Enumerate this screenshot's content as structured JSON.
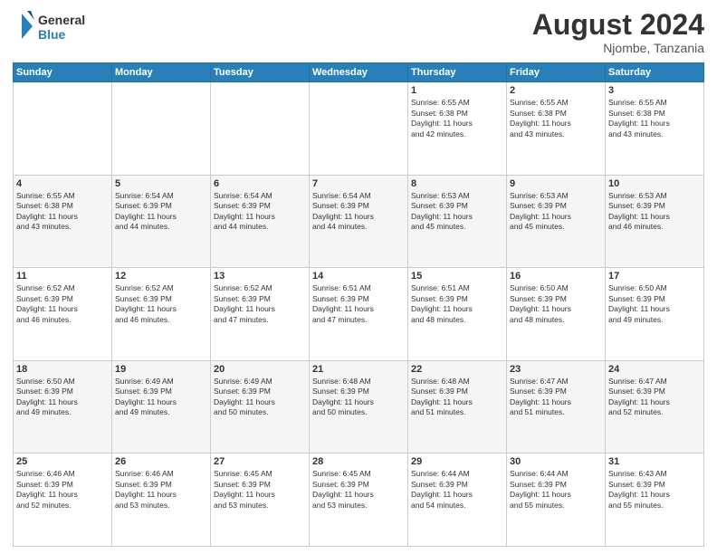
{
  "header": {
    "logo_text_general": "General",
    "logo_text_blue": "Blue",
    "month_year": "August 2024",
    "location": "Njombe, Tanzania"
  },
  "weekdays": [
    "Sunday",
    "Monday",
    "Tuesday",
    "Wednesday",
    "Thursday",
    "Friday",
    "Saturday"
  ],
  "weeks": [
    [
      {
        "day": "",
        "info": ""
      },
      {
        "day": "",
        "info": ""
      },
      {
        "day": "",
        "info": ""
      },
      {
        "day": "",
        "info": ""
      },
      {
        "day": "1",
        "info": "Sunrise: 6:55 AM\nSunset: 6:38 PM\nDaylight: 11 hours\nand 42 minutes."
      },
      {
        "day": "2",
        "info": "Sunrise: 6:55 AM\nSunset: 6:38 PM\nDaylight: 11 hours\nand 43 minutes."
      },
      {
        "day": "3",
        "info": "Sunrise: 6:55 AM\nSunset: 6:38 PM\nDaylight: 11 hours\nand 43 minutes."
      }
    ],
    [
      {
        "day": "4",
        "info": "Sunrise: 6:55 AM\nSunset: 6:38 PM\nDaylight: 11 hours\nand 43 minutes."
      },
      {
        "day": "5",
        "info": "Sunrise: 6:54 AM\nSunset: 6:39 PM\nDaylight: 11 hours\nand 44 minutes."
      },
      {
        "day": "6",
        "info": "Sunrise: 6:54 AM\nSunset: 6:39 PM\nDaylight: 11 hours\nand 44 minutes."
      },
      {
        "day": "7",
        "info": "Sunrise: 6:54 AM\nSunset: 6:39 PM\nDaylight: 11 hours\nand 44 minutes."
      },
      {
        "day": "8",
        "info": "Sunrise: 6:53 AM\nSunset: 6:39 PM\nDaylight: 11 hours\nand 45 minutes."
      },
      {
        "day": "9",
        "info": "Sunrise: 6:53 AM\nSunset: 6:39 PM\nDaylight: 11 hours\nand 45 minutes."
      },
      {
        "day": "10",
        "info": "Sunrise: 6:53 AM\nSunset: 6:39 PM\nDaylight: 11 hours\nand 46 minutes."
      }
    ],
    [
      {
        "day": "11",
        "info": "Sunrise: 6:52 AM\nSunset: 6:39 PM\nDaylight: 11 hours\nand 46 minutes."
      },
      {
        "day": "12",
        "info": "Sunrise: 6:52 AM\nSunset: 6:39 PM\nDaylight: 11 hours\nand 46 minutes."
      },
      {
        "day": "13",
        "info": "Sunrise: 6:52 AM\nSunset: 6:39 PM\nDaylight: 11 hours\nand 47 minutes."
      },
      {
        "day": "14",
        "info": "Sunrise: 6:51 AM\nSunset: 6:39 PM\nDaylight: 11 hours\nand 47 minutes."
      },
      {
        "day": "15",
        "info": "Sunrise: 6:51 AM\nSunset: 6:39 PM\nDaylight: 11 hours\nand 48 minutes."
      },
      {
        "day": "16",
        "info": "Sunrise: 6:50 AM\nSunset: 6:39 PM\nDaylight: 11 hours\nand 48 minutes."
      },
      {
        "day": "17",
        "info": "Sunrise: 6:50 AM\nSunset: 6:39 PM\nDaylight: 11 hours\nand 49 minutes."
      }
    ],
    [
      {
        "day": "18",
        "info": "Sunrise: 6:50 AM\nSunset: 6:39 PM\nDaylight: 11 hours\nand 49 minutes."
      },
      {
        "day": "19",
        "info": "Sunrise: 6:49 AM\nSunset: 6:39 PM\nDaylight: 11 hours\nand 49 minutes."
      },
      {
        "day": "20",
        "info": "Sunrise: 6:49 AM\nSunset: 6:39 PM\nDaylight: 11 hours\nand 50 minutes."
      },
      {
        "day": "21",
        "info": "Sunrise: 6:48 AM\nSunset: 6:39 PM\nDaylight: 11 hours\nand 50 minutes."
      },
      {
        "day": "22",
        "info": "Sunrise: 6:48 AM\nSunset: 6:39 PM\nDaylight: 11 hours\nand 51 minutes."
      },
      {
        "day": "23",
        "info": "Sunrise: 6:47 AM\nSunset: 6:39 PM\nDaylight: 11 hours\nand 51 minutes."
      },
      {
        "day": "24",
        "info": "Sunrise: 6:47 AM\nSunset: 6:39 PM\nDaylight: 11 hours\nand 52 minutes."
      }
    ],
    [
      {
        "day": "25",
        "info": "Sunrise: 6:46 AM\nSunset: 6:39 PM\nDaylight: 11 hours\nand 52 minutes."
      },
      {
        "day": "26",
        "info": "Sunrise: 6:46 AM\nSunset: 6:39 PM\nDaylight: 11 hours\nand 53 minutes."
      },
      {
        "day": "27",
        "info": "Sunrise: 6:45 AM\nSunset: 6:39 PM\nDaylight: 11 hours\nand 53 minutes."
      },
      {
        "day": "28",
        "info": "Sunrise: 6:45 AM\nSunset: 6:39 PM\nDaylight: 11 hours\nand 53 minutes."
      },
      {
        "day": "29",
        "info": "Sunrise: 6:44 AM\nSunset: 6:39 PM\nDaylight: 11 hours\nand 54 minutes."
      },
      {
        "day": "30",
        "info": "Sunrise: 6:44 AM\nSunset: 6:39 PM\nDaylight: 11 hours\nand 55 minutes."
      },
      {
        "day": "31",
        "info": "Sunrise: 6:43 AM\nSunset: 6:39 PM\nDaylight: 11 hours\nand 55 minutes."
      }
    ]
  ]
}
